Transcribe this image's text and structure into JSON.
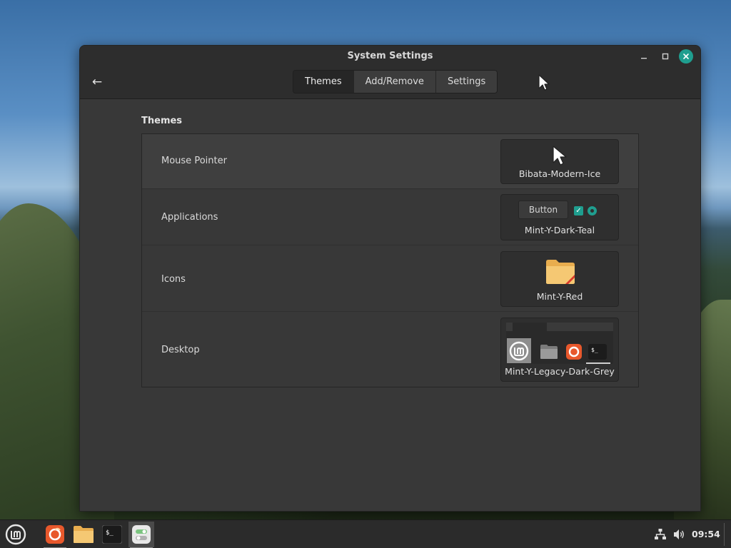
{
  "window": {
    "title": "System Settings",
    "tabs": [
      {
        "label": "Themes",
        "active": true
      },
      {
        "label": "Add/Remove",
        "active": false
      },
      {
        "label": "Settings",
        "active": false
      }
    ],
    "controls": {
      "back_icon": "arrow-left-icon",
      "minimize_icon": "minimize-icon",
      "maximize_icon": "maximize-icon",
      "close_icon": "close-icon"
    }
  },
  "themes": {
    "section_title": "Themes",
    "rows": [
      {
        "label": "Mouse Pointer",
        "value": "Bibata-Modern-Ice",
        "preview_icon": "cursor-arrow-icon"
      },
      {
        "label": "Applications",
        "value": "Mint-Y-Dark-Teal",
        "preview_button_label": "Button",
        "preview_icon": "widget-preview-icon"
      },
      {
        "label": "Icons",
        "value": "Mint-Y-Red",
        "preview_icon": "folder-icon"
      },
      {
        "label": "Desktop",
        "value": "Mint-Y-Legacy-Dark-Grey",
        "preview_icon": "desktop-panel-preview-icon"
      }
    ]
  },
  "taskbar": {
    "items": [
      {
        "name": "mint-menu-icon"
      },
      {
        "name": "firefox-icon"
      },
      {
        "name": "files-folder-icon"
      },
      {
        "name": "terminal-icon",
        "glyph": "$_"
      },
      {
        "name": "system-settings-icon"
      }
    ],
    "tray": [
      {
        "name": "network-icon"
      },
      {
        "name": "volume-icon"
      }
    ],
    "clock": "09:54"
  },
  "colors": {
    "accent": "#1f9e8f",
    "window_bg": "#383838",
    "headerbar_bg": "#2d2d2d",
    "folder": "#f2c36b",
    "firefox": "#e8582c"
  }
}
